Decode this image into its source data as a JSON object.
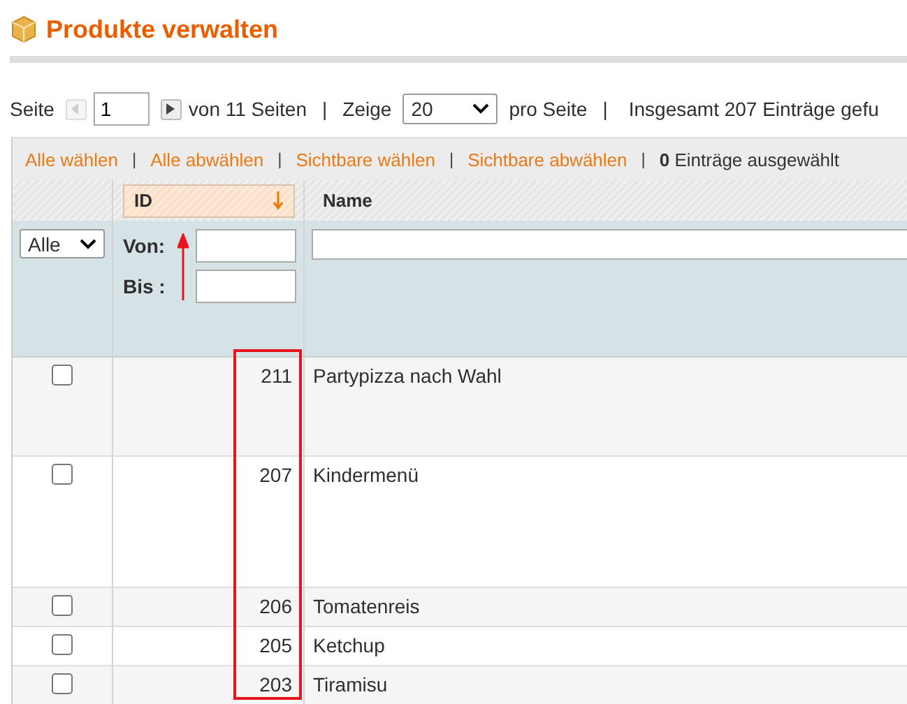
{
  "title": "Produkte verwalten",
  "pager": {
    "page_label": "Seite",
    "page_value": "1",
    "of_pages": "von 11 Seiten",
    "separator": "|",
    "show_label": "Zeige",
    "per_page": "20",
    "per_page_suffix": "pro Seite",
    "separator_2": "|",
    "total": "Insgesamt 207 Einträge gefu"
  },
  "actions": [
    {
      "label": "Alle wählen"
    },
    {
      "label": "Alle abwählen"
    },
    {
      "label": "Sichtbare wählen"
    },
    {
      "label": "Sichtbare abwählen"
    }
  ],
  "action_separator": "|",
  "selected_count": "**0** Einträge ausgewählt",
  "columns": [
    {
      "label": "ID",
      "sorted": true
    },
    {
      "label": "Name",
      "sorted": false
    }
  ],
  "filters": {
    "select": "Alle",
    "from_label": "Von:",
    "to_label": "Bis :"
  },
  "rows": [
    {
      "id": "211",
      "name": "Partypizza nach Wahl",
      "checked": false
    },
    {
      "id": "207",
      "name": "Kindermenü",
      "checked": false
    },
    {
      "id": "206",
      "name": "Tomatenreis",
      "checked": false
    },
    {
      "id": "205",
      "name": "Ketchup",
      "checked": false
    },
    {
      "id": "203",
      "name": "Tiramisu",
      "checked": false
    }
  ],
  "annotations": {
    "arrow": true,
    "highlight_box": true
  }
}
